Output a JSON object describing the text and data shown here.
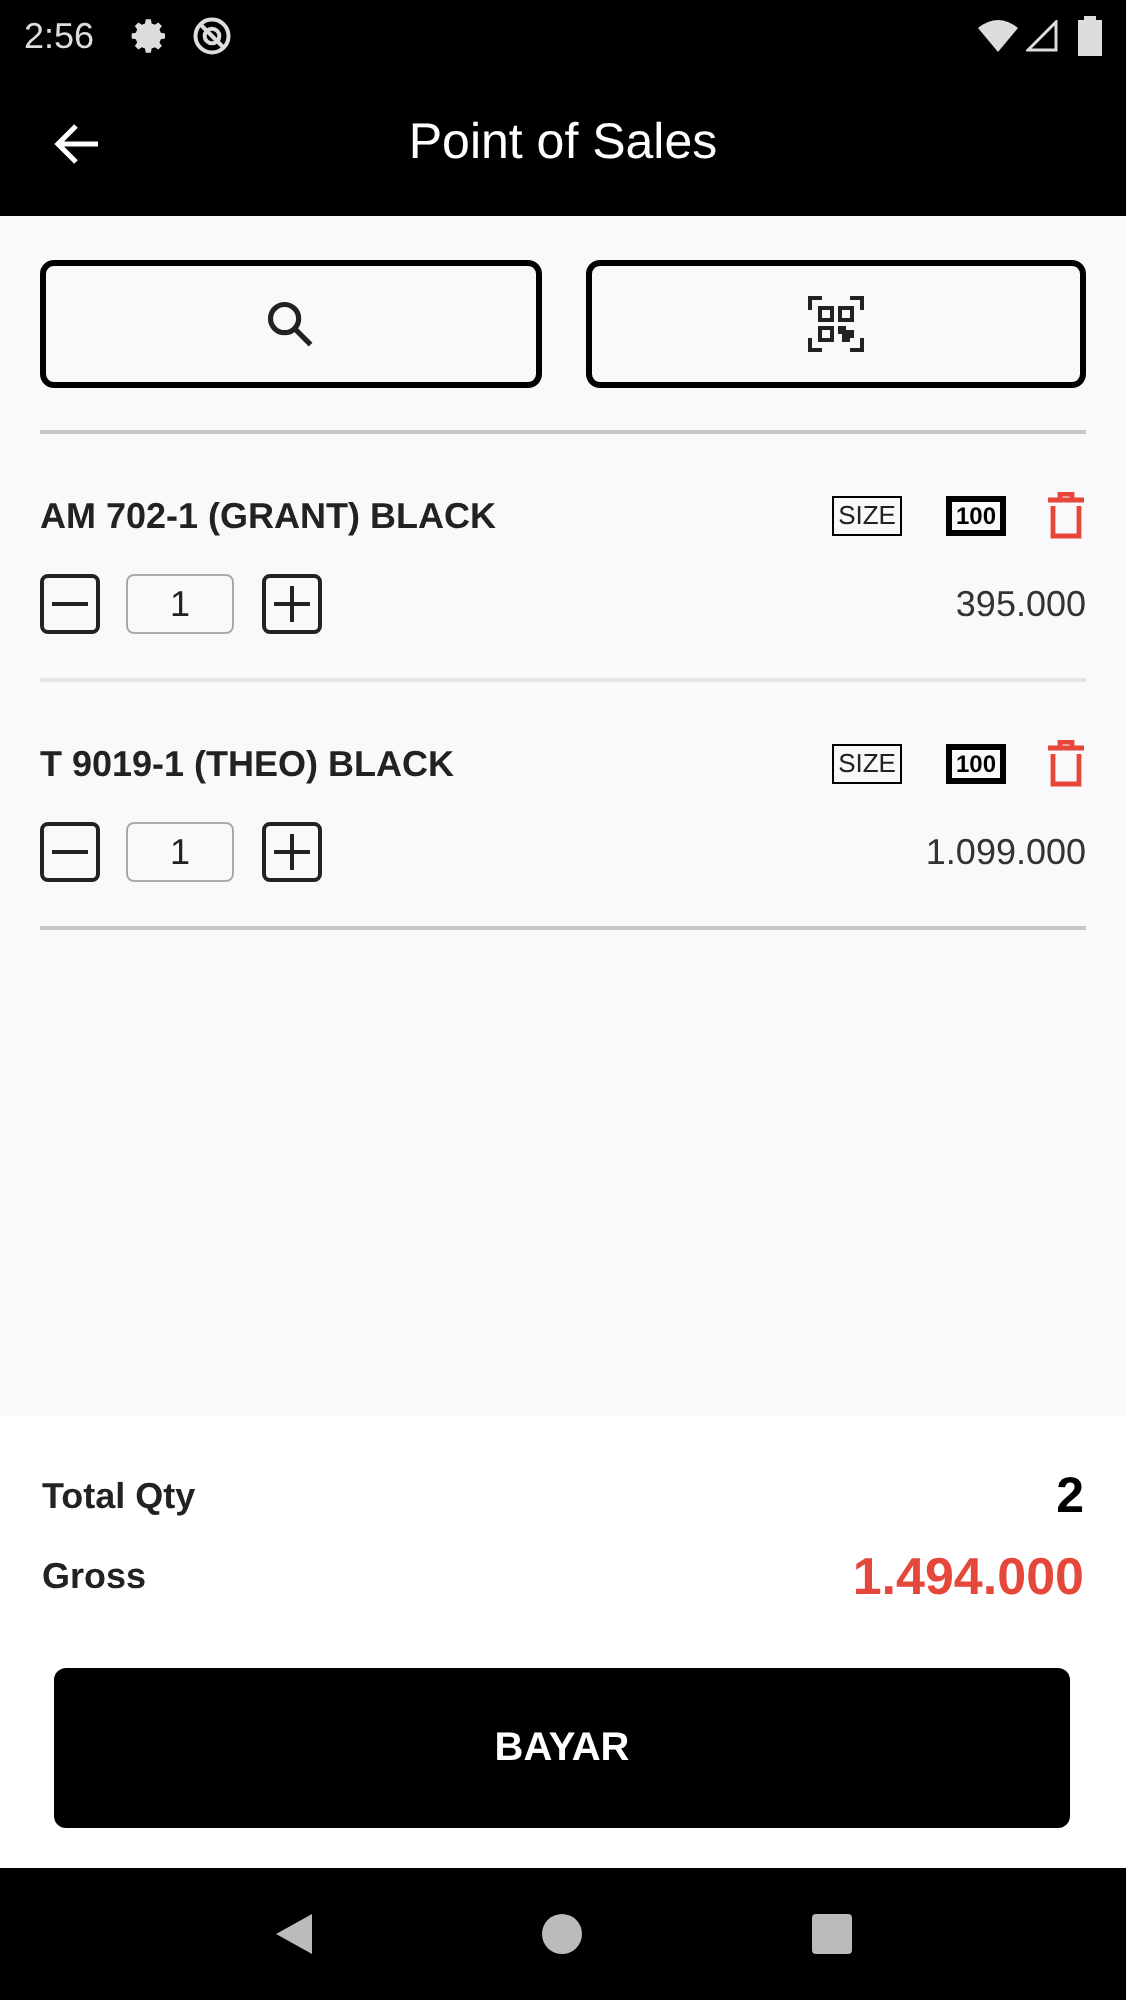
{
  "status_bar": {
    "time": "2:56"
  },
  "app_bar": {
    "title": "Point of Sales"
  },
  "items": [
    {
      "name": "AM 702-1 (GRANT) BLACK",
      "size_label": "SIZE",
      "barcode_label": "100",
      "qty": "1",
      "price": "395.000"
    },
    {
      "name": "T 9019-1 (THEO) BLACK",
      "size_label": "SIZE",
      "barcode_label": "100",
      "qty": "1",
      "price": "1.099.000"
    }
  ],
  "summary": {
    "total_qty_label": "Total Qty",
    "total_qty": "2",
    "gross_label": "Gross",
    "gross": "1.494.000"
  },
  "pay_button": "BAYAR"
}
